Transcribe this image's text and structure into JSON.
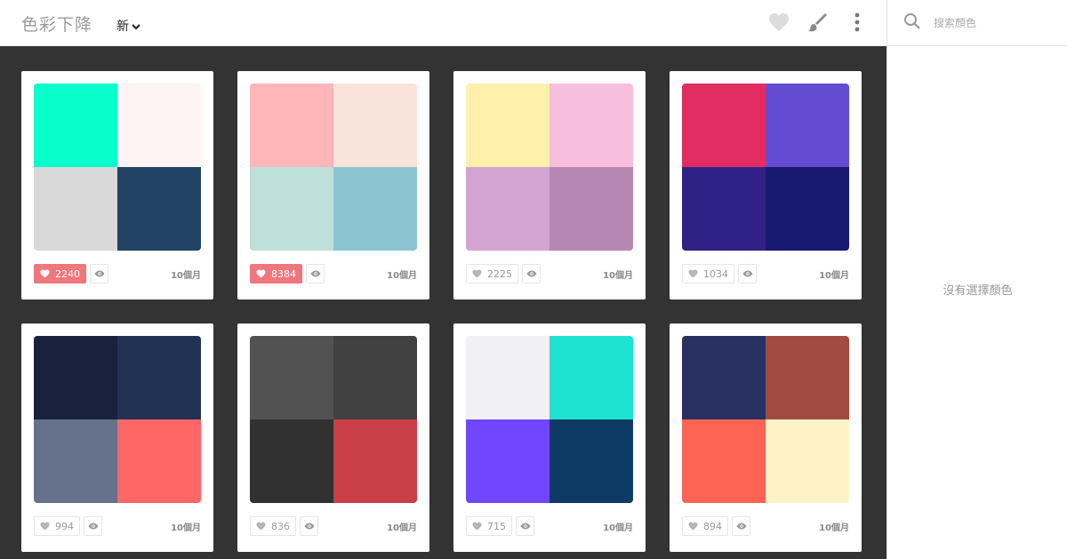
{
  "header": {
    "logo": "色彩下降",
    "sort_label": "新"
  },
  "toolbar": {
    "icons": [
      "heart-icon",
      "brush-icon",
      "more-vertical-icon"
    ]
  },
  "sidebar": {
    "search_placeholder": "搜索顏色",
    "empty_message": "沒有選擇顏色"
  },
  "cards": [
    {
      "colors": [
        "#08ffcb",
        "#fff4f4",
        "#d8d8d8",
        "#214363"
      ],
      "likes": "2240",
      "liked": true,
      "age": "10個月"
    },
    {
      "colors": [
        "#ffb6b9",
        "#f9e3da",
        "#bde0db",
        "#8bc5d2"
      ],
      "likes": "8384",
      "liked": true,
      "age": "10個月"
    },
    {
      "colors": [
        "#fff1ac",
        "#f8bedd",
        "#d3a4d0",
        "#b687b0"
      ],
      "likes": "2225",
      "liked": false,
      "age": "10個月"
    },
    {
      "colors": [
        "#e22d62",
        "#634cd2",
        "#2f2185",
        "#171a70"
      ],
      "likes": "1034",
      "liked": false,
      "age": "10個月"
    },
    {
      "colors": [
        "#19233e",
        "#223253",
        "#66728a",
        "#ff6766"
      ],
      "likes": "994",
      "liked": false,
      "age": "10個月"
    },
    {
      "colors": [
        "#525252",
        "#414141",
        "#313131",
        "#ca3e47"
      ],
      "likes": "836",
      "liked": false,
      "age": "10個月"
    },
    {
      "colors": [
        "#f1f1f4",
        "#1ee3d3",
        "#7046fe",
        "#0e3b65"
      ],
      "likes": "715",
      "liked": false,
      "age": "10個月"
    },
    {
      "colors": [
        "#283162",
        "#a24b43",
        "#fe6454",
        "#fff2c4"
      ],
      "likes": "894",
      "liked": false,
      "age": "10個月"
    }
  ]
}
